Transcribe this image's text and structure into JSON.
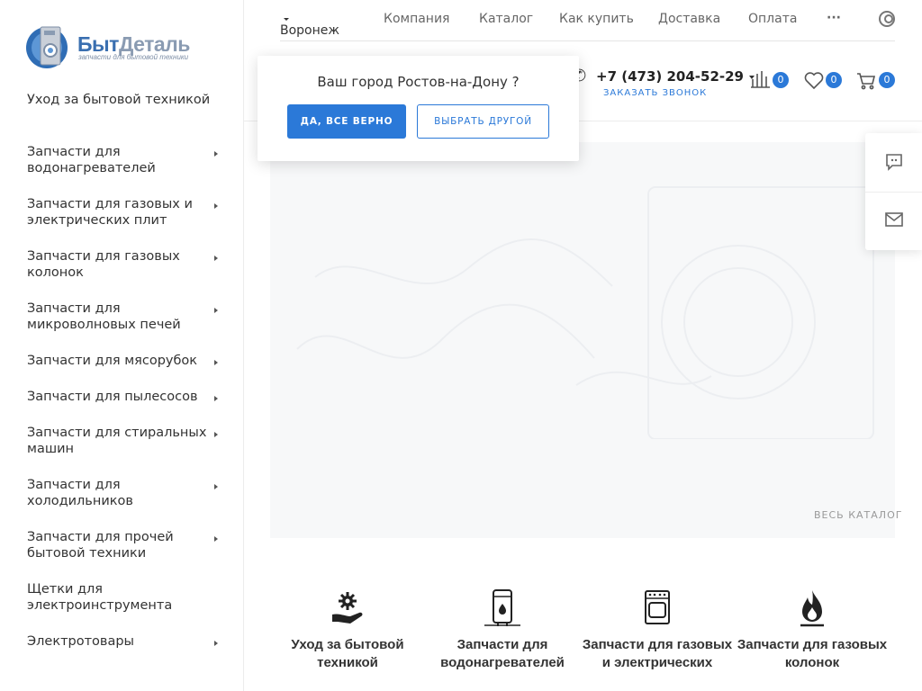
{
  "logo": {
    "brand_a": "Быт",
    "brand_b": "Деталь",
    "tagline": "запчасти для бытовой техники"
  },
  "sidebar": {
    "items": [
      {
        "label": "Уход за бытовой техникой",
        "arrow": false
      },
      {
        "label": "Запчасти для водонагревателей",
        "arrow": true
      },
      {
        "label": "Запчасти для газовых и электрических плит",
        "arrow": true
      },
      {
        "label": "Запчасти для газовых колонок",
        "arrow": true
      },
      {
        "label": "Запчасти для микроволновых печей",
        "arrow": true
      },
      {
        "label": "Запчасти для мясорубок",
        "arrow": true
      },
      {
        "label": "Запчасти для пылесосов",
        "arrow": true
      },
      {
        "label": "Запчасти для стиральных машин",
        "arrow": true
      },
      {
        "label": "Запчасти для холодильников",
        "arrow": true
      },
      {
        "label": "Запчасти для прочей бытовой техники",
        "arrow": true
      },
      {
        "label": "Щетки для электроинструмента",
        "arrow": false
      },
      {
        "label": "Электротовары",
        "arrow": true
      }
    ]
  },
  "topnav": {
    "city": "Воронеж",
    "links": [
      "Компания",
      "Каталог",
      "Как купить",
      "Доставка",
      "Оплата"
    ],
    "more": "···"
  },
  "header": {
    "phone": "+7 (473) 204-52-29",
    "callback": "ЗАКАЗАТЬ ЗВОНОК",
    "compare_count": "0",
    "wishlist_count": "0",
    "cart_count": "0"
  },
  "popup": {
    "title": "Ваш город Ростов-на-Дону ?",
    "yes_label": "ДА, ВСЕ ВЕРНО",
    "other_label": "ВЫБРАТЬ ДРУГОЙ"
  },
  "banner": {
    "all_catalog": "ВЕСЬ КАТАЛОГ"
  },
  "tiles": [
    {
      "label": "Уход за бытовой техникой",
      "icon": "hand-gear-icon"
    },
    {
      "label": "Запчасти для водонагревателей",
      "icon": "water-heater-icon"
    },
    {
      "label": "Запчасти для газовых и электрических",
      "icon": "stove-icon"
    },
    {
      "label": "Запчасти для газовых колонок",
      "icon": "flame-icon"
    }
  ],
  "colors": {
    "accent": "#2b79d8",
    "text": "#333333",
    "banner_bg": "#f7f8f9"
  }
}
